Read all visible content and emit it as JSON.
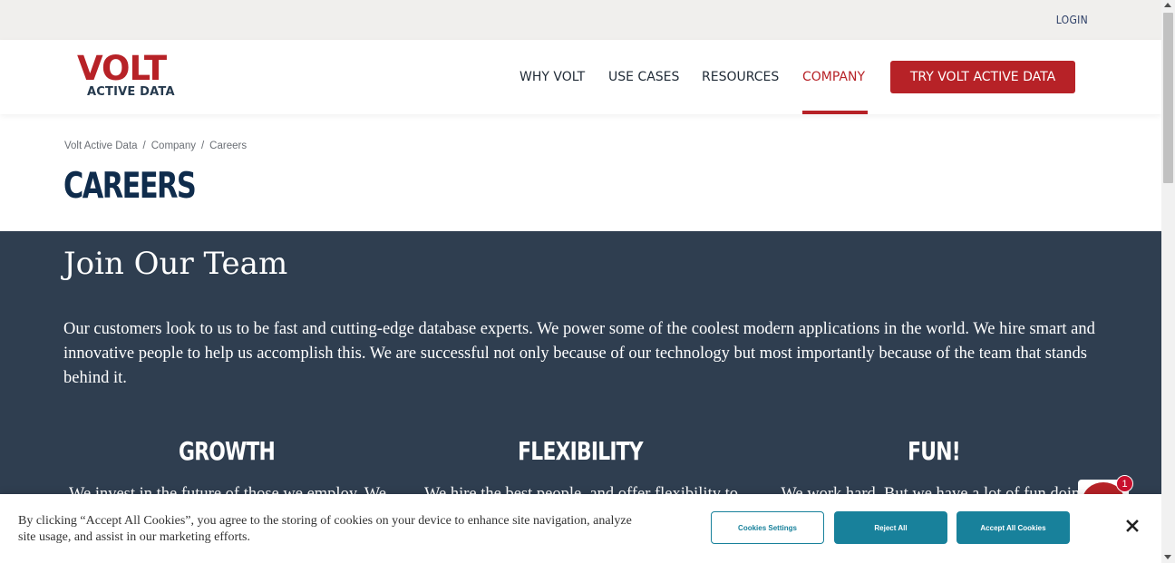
{
  "topbar": {
    "login_label": "LOGIN"
  },
  "logo": {
    "wordmark": "VOLT",
    "subtitle": "ACTIVE DATA"
  },
  "nav": {
    "items": [
      {
        "label": "WHY VOLT"
      },
      {
        "label": "USE CASES"
      },
      {
        "label": "RESOURCES"
      },
      {
        "label": "COMPANY",
        "active": true
      }
    ],
    "cta_label": "TRY VOLT ACTIVE DATA"
  },
  "breadcrumb": {
    "items": [
      "Volt Active Data",
      "Company",
      "Careers"
    ],
    "separator": "/"
  },
  "page_title": "CAREERS",
  "team": {
    "heading": "Join Our Team",
    "intro": "Our customers look to us to be fast and cutting-edge database experts. We power some of the coolest modern applications in the world. We hire smart and innovative people to help us accomplish this. We are successful not only because of our technology but most importantly because of the team that stands behind it.",
    "columns": [
      {
        "title": "GROWTH",
        "text": "We invest in the future of those we employ. We"
      },
      {
        "title": "FLEXIBILITY",
        "text": "We hire the best people, and offer flexibility to"
      },
      {
        "title": "FUN!",
        "text": "We work hard. But we have a lot of fun doing"
      }
    ]
  },
  "chat": {
    "badge_count": "1"
  },
  "cookie_banner": {
    "message": "By clicking “Accept All Cookies”, you agree to the storing of cookies on your device to enhance site navigation, analyze site usage, and assist in our marketing efforts.",
    "settings_label": "Cookies Settings",
    "reject_label": "Reject All",
    "accept_label": "Accept All Cookies"
  },
  "colors": {
    "brand_red": "#b72227",
    "navy": "#0f2c4c",
    "band": "#2f3e50",
    "cookie_teal": "#18819b"
  },
  "icons": [
    "close-icon",
    "chat-icon"
  ]
}
